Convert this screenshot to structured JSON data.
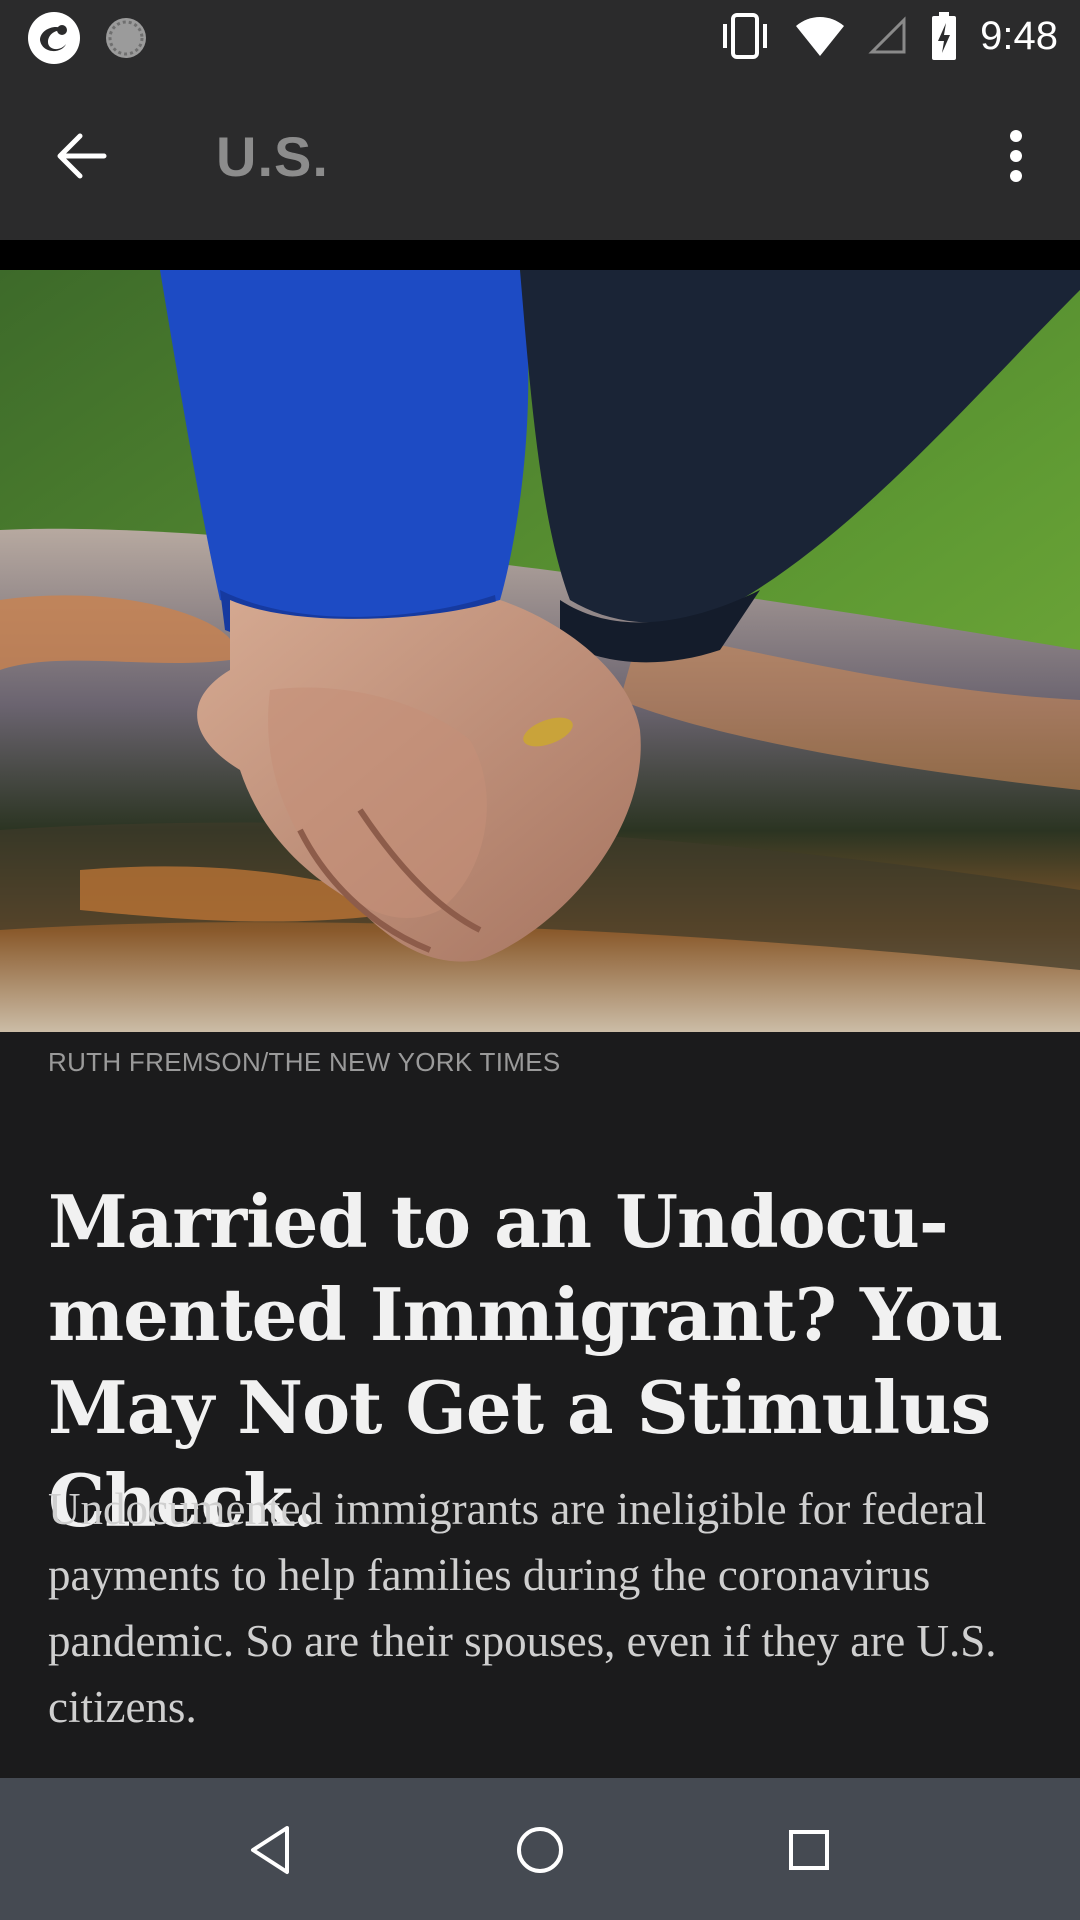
{
  "status_bar": {
    "time": "9:48",
    "icons": [
      "app-logo-icon",
      "loading-icon",
      "vibrate-icon",
      "wifi-icon",
      "cell-signal-icon",
      "battery-charging-icon"
    ]
  },
  "app_bar": {
    "title": "U.S.",
    "back_icon": "arrow-left-icon",
    "menu_icon": "more-vert-icon"
  },
  "article": {
    "photo_credit": "RUTH FREMSON/THE NEW YORK TIMES",
    "headline": "Married to an Undocu-mented Immigrant? You May Not Get a Stimulus Check.",
    "summary": "Undocumented immigrants are ineligible for federal payments to help families during the coronavirus pandemic. So are their spouses, even if they are U.S. citizens."
  },
  "nav_bar": {
    "buttons": [
      "back-triangle-icon",
      "home-circle-icon",
      "recents-square-icon"
    ]
  },
  "colors": {
    "background": "#1b1b1c",
    "bar": "#2b2b2c",
    "nav": "#454a52"
  }
}
